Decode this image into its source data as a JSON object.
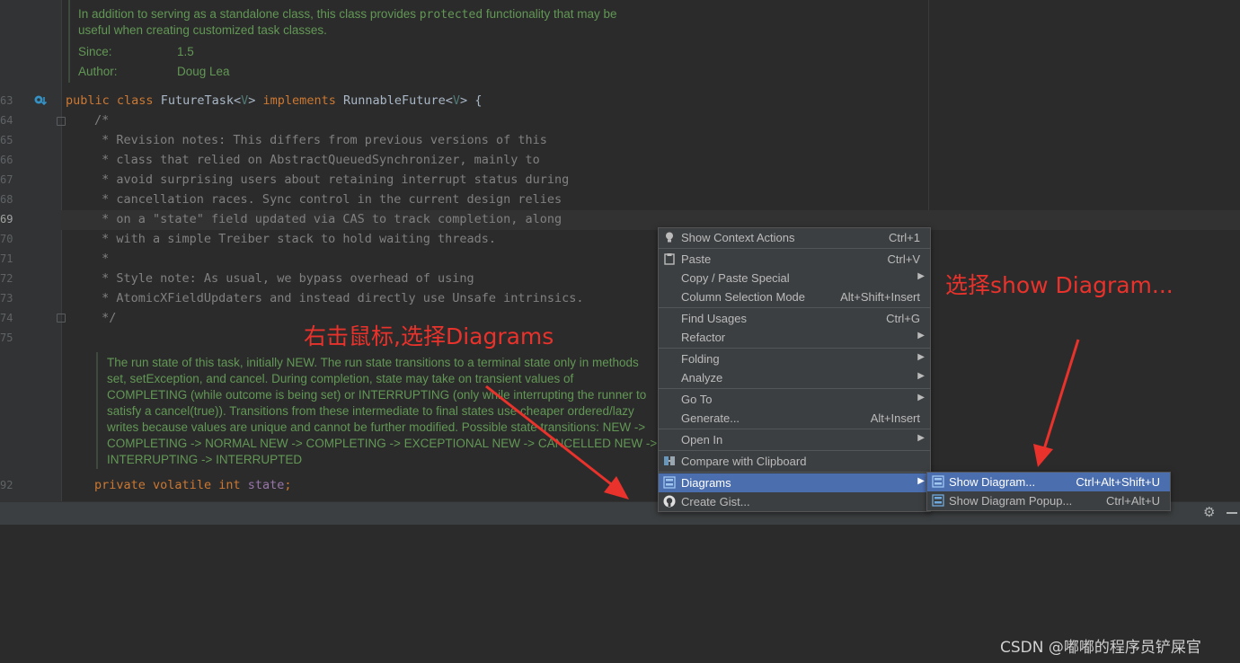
{
  "editor": {
    "doc_top": {
      "line1_pre": "In addition to serving as a standalone class, this class provides ",
      "line1_code": "protected",
      "line1_post": " functionality that may be",
      "line2": "useful when creating customized task classes.",
      "since_label": "Since:",
      "since_value": "1.5",
      "author_label": "Author:",
      "author_value": "Doug Lea"
    },
    "line_numbers": [
      "63",
      "64",
      "65",
      "66",
      "67",
      "68",
      "69",
      "70",
      "71",
      "72",
      "73",
      "74",
      "75",
      "92"
    ],
    "class_decl": {
      "kw1": "public",
      "kw2": "class",
      "name": "FutureTask",
      "lt1": "<",
      "tp1": "V",
      "gt1": ">",
      "kw3": "implements",
      "iface": "RunnableFuture",
      "lt2": "<",
      "tp2": "V",
      "gt2": ">",
      "brace": "{"
    },
    "comment_lines": [
      "/*",
      " * Revision notes: This differs from previous versions of this",
      " * class that relied on AbstractQueuedSynchronizer, mainly to",
      " * avoid surprising users about retaining interrupt status during",
      " * cancellation races. Sync control in the current design relies",
      " * on a \"state\" field updated via CAS to track completion, along",
      " * with a simple Treiber stack to hold waiting threads.",
      " *",
      " * Style note: As usual, we bypass overhead of using",
      " * AtomicXFieldUpdaters and instead directly use Unsafe intrinsics.",
      " */"
    ],
    "doc_state": [
      "The run state of this task, initially NEW. The run state transitions to a terminal state only in methods",
      "set, setException, and cancel. During completion, state may take on transient values of",
      "COMPLETING (while outcome is being set) or INTERRUPTING (only while interrupting the runner to",
      "satisfy a cancel(true)). Transitions from these intermediate to final states use cheaper ordered/lazy",
      "writes because values are unique and cannot be further modified. Possible state transitions: NEW ->",
      "COMPLETING -> NORMAL NEW -> COMPLETING -> EXCEPTIONAL NEW -> CANCELLED NEW ->",
      "INTERRUPTING -> INTERRUPTED"
    ],
    "field_decl": {
      "kw1": "private",
      "kw2": "volatile",
      "kw3": "int",
      "name": "state",
      "semi": ";"
    }
  },
  "annotations": {
    "right_click": "右击鼠标,选择Diagrams",
    "select_show": "选择show Diagram..."
  },
  "context_menu": {
    "items": [
      {
        "label": "Show Context Actions",
        "shortcut": "Ctrl+1",
        "icon": "lightbulb-icon"
      },
      {
        "label": "Paste",
        "shortcut": "Ctrl+V",
        "icon": "clipboard-icon"
      },
      {
        "label": "Copy / Paste Special",
        "shortcut": ""
      },
      {
        "label": "Column Selection Mode",
        "shortcut": "Alt+Shift+Insert"
      },
      {
        "label": "Find Usages",
        "shortcut": "Ctrl+G"
      },
      {
        "label": "Refactor",
        "shortcut": ""
      },
      {
        "label": "Folding",
        "shortcut": ""
      },
      {
        "label": "Analyze",
        "shortcut": ""
      },
      {
        "label": "Go To",
        "shortcut": ""
      },
      {
        "label": "Generate...",
        "shortcut": "Alt+Insert"
      },
      {
        "label": "Open In",
        "shortcut": ""
      },
      {
        "label": "Compare with Clipboard",
        "shortcut": "",
        "icon": "compare-icon"
      },
      {
        "label": "Diagrams",
        "shortcut": "",
        "icon": "diagram-icon"
      },
      {
        "label": "Create Gist...",
        "shortcut": "",
        "icon": "github-icon"
      }
    ],
    "submenu_arrow": "▶"
  },
  "diagrams_submenu": {
    "items": [
      {
        "label": "Show Diagram...",
        "shortcut": "Ctrl+Alt+Shift+U",
        "icon": "diagram-icon"
      },
      {
        "label": "Show Diagram Popup...",
        "shortcut": "Ctrl+Alt+U",
        "icon": "diagram-popup-icon"
      }
    ]
  },
  "watermark": "CSDN @嘟嘟的程序员铲屎官",
  "colors": {
    "editor_bg": "#2b2b2b",
    "keyword": "#cc7832",
    "doc_text": "#629755",
    "menu_selected": "#4b6eaf",
    "annotation": "#e8322b"
  }
}
